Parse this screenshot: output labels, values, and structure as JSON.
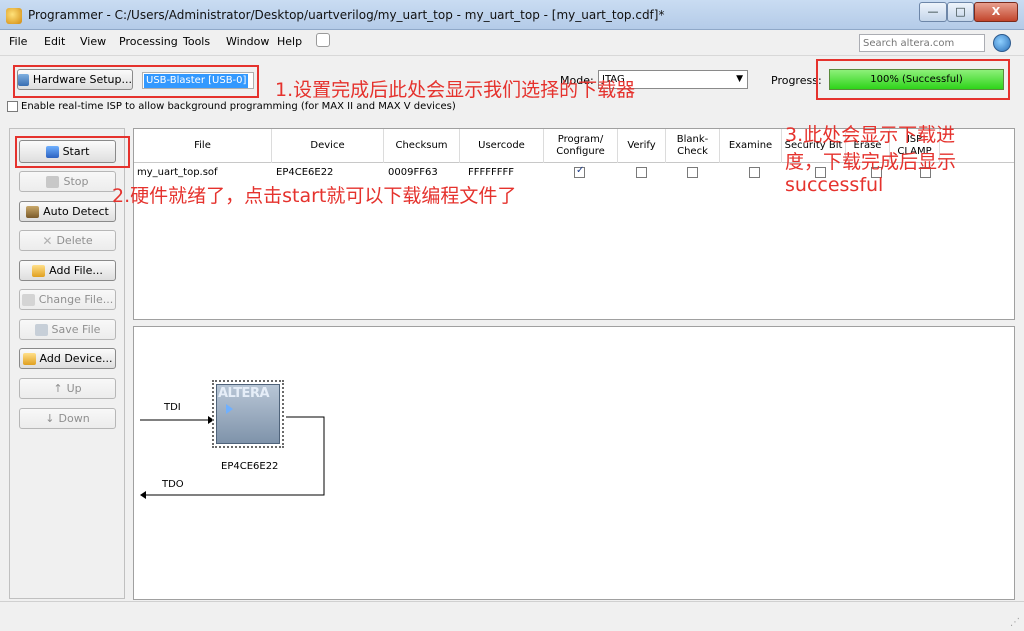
{
  "window": {
    "title": "Programmer - C:/Users/Administrator/Desktop/uartverilog/my_uart_top - my_uart_top - [my_uart_top.cdf]*",
    "minimize_label": "—",
    "maximize_label": "□",
    "close_label": "X"
  },
  "menu": [
    "File",
    "Edit",
    "View",
    "Processing",
    "Tools",
    "Window",
    "Help"
  ],
  "search": {
    "placeholder": "Search altera.com"
  },
  "toolbar": {
    "hardware_setup_label": "Hardware Setup...",
    "hardware_value": "USB-Blaster [USB-0]",
    "mode_label": "Mode:",
    "mode_value": "JTAG",
    "progress_label": "Progress:",
    "progress_text": "100% (Successful)",
    "progress_fraction": 1.0,
    "progress_color": "#2fd41a",
    "realtime_isp_label": "Enable real-time ISP to allow background programming (for MAX II and MAX V devices)",
    "realtime_isp_checked": false
  },
  "side_buttons": {
    "start": "Start",
    "stop": "Stop",
    "auto_detect": "Auto Detect",
    "delete": "Delete",
    "add_file": "Add File...",
    "change_file": "Change File...",
    "save_file": "Save File",
    "add_device": "Add Device...",
    "up": "Up",
    "down": "Down"
  },
  "table": {
    "headers": {
      "file": "File",
      "device": "Device",
      "checksum": "Checksum",
      "usercode": "Usercode",
      "program": "Program/ Configure",
      "verify": "Verify",
      "blank_check": "Blank- Check",
      "examine": "Examine",
      "security": "Security Bit",
      "erase": "Erase",
      "isp_clamp": "ISP CLAMP"
    },
    "rows": [
      {
        "file": "my_uart_top.sof",
        "device": "EP4CE6E22",
        "checksum": "0009FF63",
        "usercode": "FFFFFFFF",
        "program": true,
        "verify": false,
        "blank_check": false,
        "examine": false,
        "security": false,
        "erase": false,
        "isp_clamp": false
      }
    ]
  },
  "chain": {
    "tdi_label": "TDI",
    "tdo_label": "TDO",
    "chip_logo": "ALTERA",
    "chip_name": "EP4CE6E22"
  },
  "annotations": {
    "note1": "1.设置完成后此处会显示我们选择的下载器",
    "note2": "2.硬件就绪了，点击start就可以下载编程文件了",
    "note3_line1": "3.此处会显示下载进",
    "note3_line2": "度，下载完成后显示",
    "note3_line3": "successful",
    "color": "#e5322d"
  }
}
